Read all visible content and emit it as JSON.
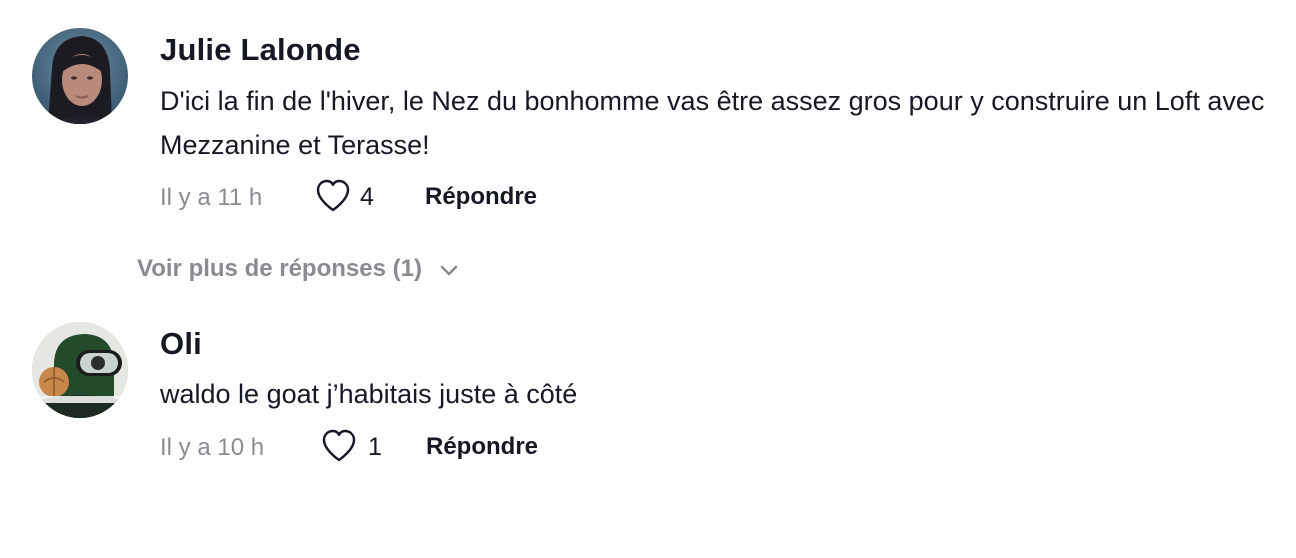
{
  "comments": [
    {
      "username": "Julie Lalonde",
      "text": "D'ici la fin de l'hiver, le Nez du bonhomme vas être assez gros pour y construire un Loft avec Mezzanine et Terasse!",
      "time": "Il y a 11 h",
      "likes": "4",
      "reply_label": "Répondre",
      "like_icon": "heart-outline-icon"
    },
    {
      "username": "Oli",
      "text": "waldo le goat j’habitais juste à côté",
      "time": "Il y a 10 h",
      "likes": "1",
      "reply_label": "Répondre",
      "like_icon": "heart-outline-icon"
    }
  ],
  "more_replies": {
    "label": "Voir plus de réponses (1)",
    "icon": "chevron-down-icon"
  },
  "colors": {
    "text_primary": "#161823",
    "text_secondary": "#8a8b91",
    "background": "#ffffff"
  }
}
